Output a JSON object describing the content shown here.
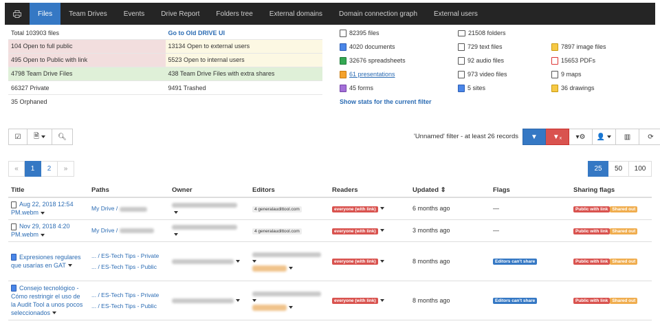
{
  "nav": {
    "tabs": [
      "Files",
      "Team Drives",
      "Events",
      "Drive Report",
      "Folders tree",
      "External domains",
      "Domain connection graph",
      "External users"
    ]
  },
  "stats_left": {
    "r0": [
      "Total 103903 files",
      "Go to Old DRIVE UI"
    ],
    "r1": [
      "104 Open to full public",
      "13134 Open to external users"
    ],
    "r2": [
      "495 Open to Public with link",
      "5523 Open to internal users"
    ],
    "r3": [
      "4798 Team Drive Files",
      "438 Team Drive Files with extra shares"
    ],
    "r4": [
      "66327 Private",
      "9491 Trashed"
    ],
    "r5": [
      "35 Orphaned",
      ""
    ]
  },
  "stats_right": {
    "files": "82395 files",
    "folders": "21508 folders",
    "documents": "4020 documents",
    "text": "729 text files",
    "images": "7897 image files",
    "spreadsheets": "32676 spreadsheets",
    "audio": "92 audio files",
    "pdfs": "15653 PDFs",
    "presentations": "61 presentations",
    "video": "973 video files",
    "maps": "9 maps",
    "forms": "45 forms",
    "sites": "5 sites",
    "drawings": "36 drawings",
    "show_stats": "Show stats for the current filter"
  },
  "filter_text": "'Unnamed' filter -  at least 26 records",
  "pager": {
    "prev": "«",
    "p1": "1",
    "p2": "2",
    "next": "»"
  },
  "page_sizes": [
    "25",
    "50",
    "100"
  ],
  "table": {
    "headers": [
      "Title",
      "Paths",
      "Owner",
      "Editors",
      "Readers",
      "Updated ⇕",
      "Flags",
      "Sharing flags"
    ],
    "rows": [
      {
        "title": "Aug 22, 2018 12:54 PM.webm",
        "paths": [
          "My Drive /"
        ],
        "editor": "4 generalaudittool.com",
        "reader": "everyone (with link)",
        "updated": "6 months ago",
        "flag": "—",
        "share1": "Public with link",
        "share2": "Shared out"
      },
      {
        "title": "Nov 29, 2018 4:20 PM.webm",
        "paths": [
          "My Drive /"
        ],
        "editor": "4 generalaudittool.com",
        "reader": "everyone (with link)",
        "updated": "3 months ago",
        "flag": "—",
        "share1": "Public with link",
        "share2": "Shared out"
      },
      {
        "title": "Expresiones regulares que usarías en GAT",
        "paths": [
          "... / ES-Tech Tips - Private",
          "... / ES-Tech Tips - Public"
        ],
        "reader": "everyone (with link)",
        "updated": "8 months ago",
        "flag": "Editors can't share",
        "share1": "Public with link",
        "share2": "Shared out"
      },
      {
        "title": "Consejo tecnológico - Cómo restringir el uso de la Audit Tool a unos pocos seleccionados",
        "paths": [
          "... / ES-Tech Tips - Private",
          "... / ES-Tech Tips - Public"
        ],
        "reader": "everyone (with link)",
        "updated": "8 months ago",
        "flag": "Editors can't share",
        "share1": "Public with link",
        "share2": "Shared out"
      }
    ]
  }
}
